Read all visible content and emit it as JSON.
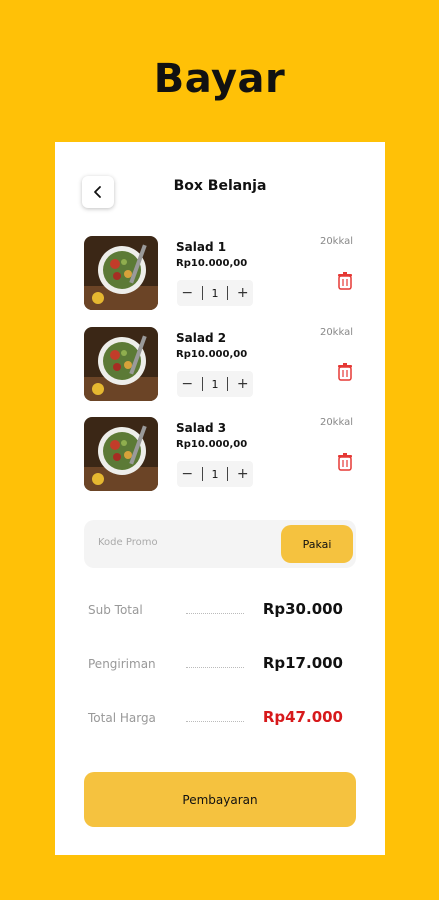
{
  "page": {
    "title": "Bayar"
  },
  "header": {
    "title": "Box Belanja",
    "back_icon": "chevron-left-icon"
  },
  "cart": {
    "items": [
      {
        "name": "Salad 1",
        "price": "Rp10.000,00",
        "kcal": "20kkal",
        "qty": "1",
        "minus": "−",
        "plus": "+",
        "delete_icon": "trash-icon"
      },
      {
        "name": "Salad 2",
        "price": "Rp10.000,00",
        "kcal": "20kkal",
        "qty": "1",
        "minus": "−",
        "plus": "+",
        "delete_icon": "trash-icon"
      },
      {
        "name": "Salad 3",
        "price": "Rp10.000,00",
        "kcal": "20kkal",
        "qty": "1",
        "minus": "−",
        "plus": "+",
        "delete_icon": "trash-icon"
      }
    ]
  },
  "promo": {
    "placeholder": "Kode Promo",
    "button_label": "Pakai"
  },
  "summary": {
    "subtotal_label": "Sub Total",
    "subtotal_value": "Rp30.000",
    "shipping_label": "Pengiriman",
    "shipping_value": "Rp17.000",
    "total_label": "Total Harga",
    "total_value": "Rp47.000"
  },
  "actions": {
    "pay_label": "Pembayaran"
  },
  "colors": {
    "background": "#FFC107",
    "accent": "#F5C23F",
    "total": "#D7191B",
    "trash": "#E53935"
  }
}
